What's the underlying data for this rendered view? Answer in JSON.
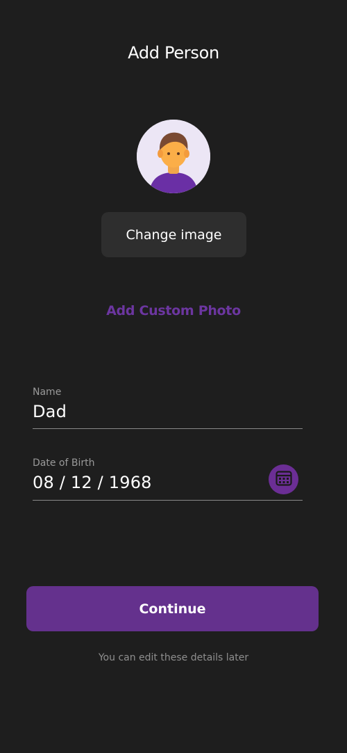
{
  "header": {
    "title": "Add Person"
  },
  "avatar": {
    "icon": "person-avatar-icon"
  },
  "buttons": {
    "change_image": "Change image",
    "add_custom_photo": "Add Custom Photo",
    "continue": "Continue"
  },
  "form": {
    "name": {
      "label": "Name",
      "value": "Dad"
    },
    "dob": {
      "label": "Date of Birth",
      "value": "08 / 12 / 1968",
      "icon": "calendar-icon"
    }
  },
  "footer": {
    "hint": "You can edit these details later"
  },
  "colors": {
    "background": "#1e1e1e",
    "accent": "#64318d",
    "link": "#6c36a0",
    "secondary_button": "#2e2e2e"
  }
}
